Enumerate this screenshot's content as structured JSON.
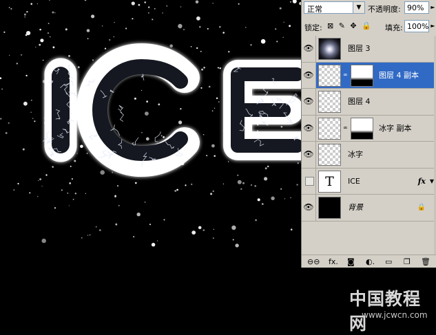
{
  "panel": {
    "blend_mode": "正常",
    "opacity_label": "不透明度:",
    "opacity_value": "90%",
    "lock_label": "锁定:",
    "lock_icons": "⊠ ✎ ✥ 🔒",
    "fill_label": "填充:",
    "fill_value": "100%",
    "layers": [
      {
        "name": "图层 3",
        "visible": true,
        "selected": false,
        "thumb": "radial",
        "mask": false,
        "icon": "eye"
      },
      {
        "name": "图层 4 副本",
        "visible": true,
        "selected": true,
        "thumb": "checker",
        "mask": true,
        "icon": "eye"
      },
      {
        "name": "图层 4",
        "visible": true,
        "selected": false,
        "thumb": "checker",
        "mask": false,
        "icon": "eye"
      },
      {
        "name": "冰字 副本",
        "visible": true,
        "selected": false,
        "thumb": "checker",
        "mask": true,
        "icon": "eye"
      },
      {
        "name": "冰字",
        "visible": true,
        "selected": false,
        "thumb": "checker",
        "mask": false,
        "icon": "eye"
      },
      {
        "name": "ICE",
        "visible": false,
        "selected": false,
        "thumb": "text",
        "thumb_label": "T",
        "fx": "fx",
        "mask": false
      },
      {
        "name": "背景",
        "visible": true,
        "selected": false,
        "thumb": "black",
        "locked": true,
        "italic": true,
        "mask": false
      }
    ],
    "bottom_icons": [
      "link-layers-icon",
      "fx-icon",
      "add-mask-icon",
      "adjustment-layer-icon",
      "new-group-icon",
      "new-layer-icon",
      "delete-layer-icon"
    ],
    "bottom_glyphs": [
      "⊖⊖",
      "fx.",
      "◙",
      "◐.",
      "▭",
      "❐",
      "🗑"
    ]
  },
  "canvas": {
    "text": "ICE",
    "colors": {
      "background": "#000000",
      "glow": "#ffffff",
      "ice": "#e8f0ff"
    }
  },
  "watermark": {
    "title": "中国教程网",
    "url": "www.jcwcn.com"
  }
}
